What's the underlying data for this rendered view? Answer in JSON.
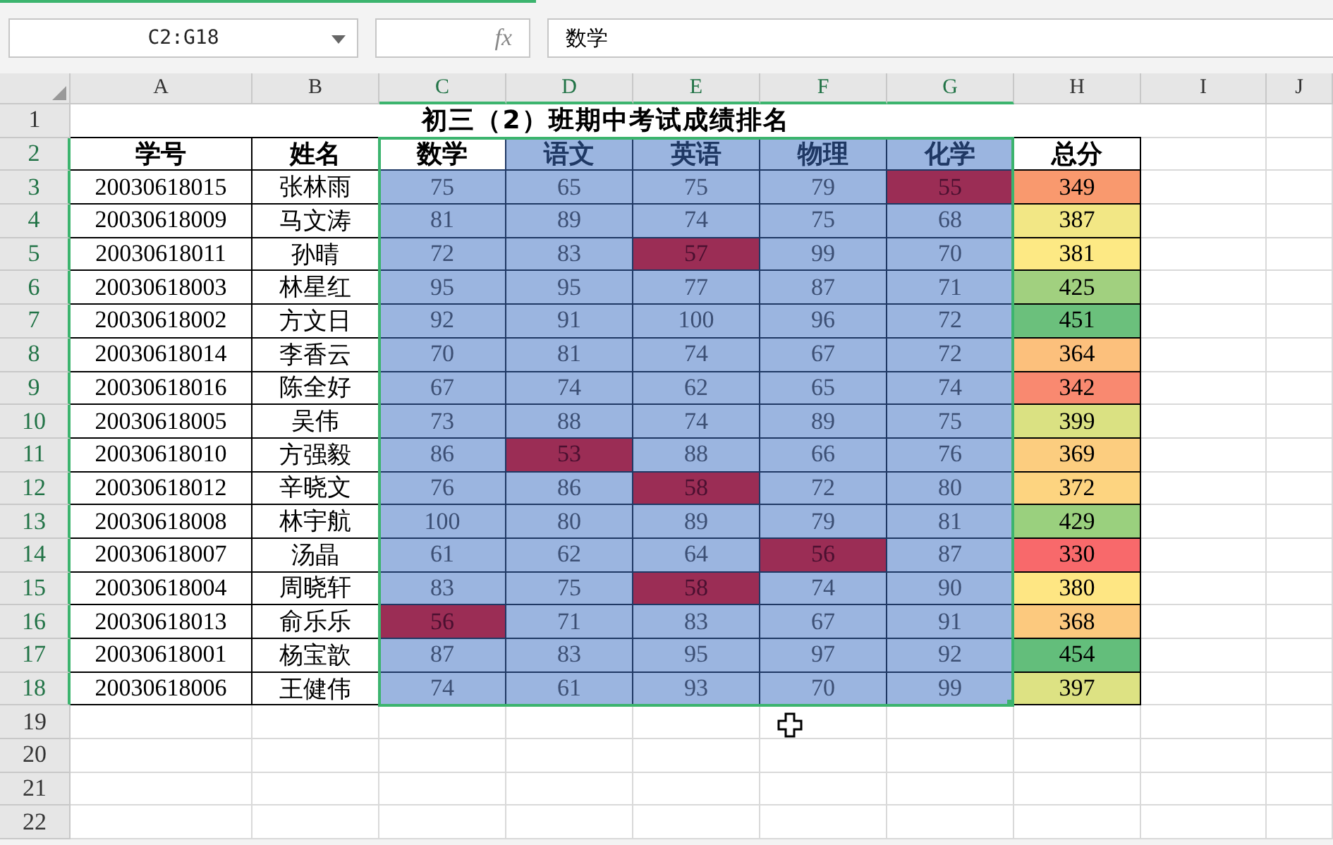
{
  "formula_bar": {
    "name_box": "C2:G18",
    "fx": "fx",
    "formula": "数学"
  },
  "column_headers": [
    {
      "label": "A",
      "selected": false
    },
    {
      "label": "B",
      "selected": false
    },
    {
      "label": "C",
      "selected": true
    },
    {
      "label": "D",
      "selected": true
    },
    {
      "label": "E",
      "selected": true
    },
    {
      "label": "F",
      "selected": true
    },
    {
      "label": "G",
      "selected": true
    },
    {
      "label": "H",
      "selected": false
    },
    {
      "label": "I",
      "selected": false
    },
    {
      "label": "J",
      "selected": false
    }
  ],
  "row_headers": [
    {
      "label": "1",
      "selected": false
    },
    {
      "label": "2",
      "selected": true
    },
    {
      "label": "3",
      "selected": true
    },
    {
      "label": "4",
      "selected": true
    },
    {
      "label": "5",
      "selected": true
    },
    {
      "label": "6",
      "selected": true
    },
    {
      "label": "7",
      "selected": true
    },
    {
      "label": "8",
      "selected": true
    },
    {
      "label": "9",
      "selected": true
    },
    {
      "label": "10",
      "selected": true
    },
    {
      "label": "11",
      "selected": true
    },
    {
      "label": "12",
      "selected": true
    },
    {
      "label": "13",
      "selected": true
    },
    {
      "label": "14",
      "selected": true
    },
    {
      "label": "15",
      "selected": true
    },
    {
      "label": "16",
      "selected": true
    },
    {
      "label": "17",
      "selected": true
    },
    {
      "label": "18",
      "selected": true
    },
    {
      "label": "19",
      "selected": false
    },
    {
      "label": "20",
      "selected": false
    },
    {
      "label": "21",
      "selected": false
    },
    {
      "label": "22",
      "selected": false
    }
  ],
  "table": {
    "title": "初三（2）班期中考试成绩排名",
    "headers": [
      {
        "label": "学号",
        "kind": "plain"
      },
      {
        "label": "姓名",
        "kind": "plain"
      },
      {
        "label": "数学",
        "kind": "subject",
        "active": true
      },
      {
        "label": "语文",
        "kind": "subject",
        "active": false
      },
      {
        "label": "英语",
        "kind": "subject",
        "active": false
      },
      {
        "label": "物理",
        "kind": "subject",
        "active": false
      },
      {
        "label": "化学",
        "kind": "subject",
        "active": false
      },
      {
        "label": "总分",
        "kind": "plain"
      }
    ],
    "rows": [
      {
        "id": "20030618015",
        "name": "张林雨",
        "scores": [
          {
            "value": "75",
            "low": false
          },
          {
            "value": "65",
            "low": false
          },
          {
            "value": "75",
            "low": false
          },
          {
            "value": "79",
            "low": false
          },
          {
            "value": "55",
            "low": true
          }
        ],
        "total": {
          "value": "349",
          "color": "#f9996e"
        }
      },
      {
        "id": "20030618009",
        "name": "马文涛",
        "scores": [
          {
            "value": "81",
            "low": false
          },
          {
            "value": "89",
            "low": false
          },
          {
            "value": "74",
            "low": false
          },
          {
            "value": "75",
            "low": false
          },
          {
            "value": "68",
            "low": false
          }
        ],
        "total": {
          "value": "387",
          "color": "#f2e785"
        }
      },
      {
        "id": "20030618011",
        "name": "孙晴",
        "scores": [
          {
            "value": "72",
            "low": false
          },
          {
            "value": "83",
            "low": false
          },
          {
            "value": "57",
            "low": true
          },
          {
            "value": "99",
            "low": false
          },
          {
            "value": "70",
            "low": false
          }
        ],
        "total": {
          "value": "381",
          "color": "#fde984"
        }
      },
      {
        "id": "20030618003",
        "name": "林星红",
        "scores": [
          {
            "value": "95",
            "low": false
          },
          {
            "value": "95",
            "low": false
          },
          {
            "value": "77",
            "low": false
          },
          {
            "value": "87",
            "low": false
          },
          {
            "value": "71",
            "low": false
          }
        ],
        "total": {
          "value": "425",
          "color": "#a1d07f"
        }
      },
      {
        "id": "20030618002",
        "name": "方文日",
        "scores": [
          {
            "value": "92",
            "low": false
          },
          {
            "value": "91",
            "low": false
          },
          {
            "value": "100",
            "low": false
          },
          {
            "value": "96",
            "low": false
          },
          {
            "value": "72",
            "low": false
          }
        ],
        "total": {
          "value": "451",
          "color": "#6bc07c"
        }
      },
      {
        "id": "20030618014",
        "name": "李香云",
        "scores": [
          {
            "value": "70",
            "low": false
          },
          {
            "value": "81",
            "low": false
          },
          {
            "value": "74",
            "low": false
          },
          {
            "value": "67",
            "low": false
          },
          {
            "value": "72",
            "low": false
          }
        ],
        "total": {
          "value": "364",
          "color": "#fcc07c"
        }
      },
      {
        "id": "20030618016",
        "name": "陈全好",
        "scores": [
          {
            "value": "67",
            "low": false
          },
          {
            "value": "74",
            "low": false
          },
          {
            "value": "62",
            "low": false
          },
          {
            "value": "65",
            "low": false
          },
          {
            "value": "74",
            "low": false
          }
        ],
        "total": {
          "value": "342",
          "color": "#f98970"
        }
      },
      {
        "id": "20030618005",
        "name": "吴伟",
        "scores": [
          {
            "value": "73",
            "low": false
          },
          {
            "value": "88",
            "low": false
          },
          {
            "value": "74",
            "low": false
          },
          {
            "value": "89",
            "low": false
          },
          {
            "value": "75",
            "low": false
          }
        ],
        "total": {
          "value": "399",
          "color": "#dae182"
        }
      },
      {
        "id": "20030618010",
        "name": "方强毅",
        "scores": [
          {
            "value": "86",
            "low": false
          },
          {
            "value": "53",
            "low": true
          },
          {
            "value": "88",
            "low": false
          },
          {
            "value": "66",
            "low": false
          },
          {
            "value": "76",
            "low": false
          }
        ],
        "total": {
          "value": "369",
          "color": "#fccd7f"
        }
      },
      {
        "id": "20030618012",
        "name": "辛晓文",
        "scores": [
          {
            "value": "76",
            "low": false
          },
          {
            "value": "86",
            "low": false
          },
          {
            "value": "58",
            "low": true
          },
          {
            "value": "72",
            "low": false
          },
          {
            "value": "80",
            "low": false
          }
        ],
        "total": {
          "value": "372",
          "color": "#fdd480"
        }
      },
      {
        "id": "20030618008",
        "name": "林宇航",
        "scores": [
          {
            "value": "100",
            "low": false
          },
          {
            "value": "80",
            "low": false
          },
          {
            "value": "89",
            "low": false
          },
          {
            "value": "79",
            "low": false
          },
          {
            "value": "81",
            "low": false
          }
        ],
        "total": {
          "value": "429",
          "color": "#9ad07e"
        }
      },
      {
        "id": "20030618007",
        "name": "汤晶",
        "scores": [
          {
            "value": "61",
            "low": false
          },
          {
            "value": "62",
            "low": false
          },
          {
            "value": "64",
            "low": false
          },
          {
            "value": "56",
            "low": true
          },
          {
            "value": "87",
            "low": false
          }
        ],
        "total": {
          "value": "330",
          "color": "#f8696b"
        }
      },
      {
        "id": "20030618004",
        "name": "周晓轩",
        "scores": [
          {
            "value": "83",
            "low": false
          },
          {
            "value": "75",
            "low": false
          },
          {
            "value": "58",
            "low": true
          },
          {
            "value": "74",
            "low": false
          },
          {
            "value": "90",
            "low": false
          }
        ],
        "total": {
          "value": "380",
          "color": "#fee683"
        }
      },
      {
        "id": "20030618013",
        "name": "俞乐乐",
        "scores": [
          {
            "value": "56",
            "low": true
          },
          {
            "value": "71",
            "low": false
          },
          {
            "value": "83",
            "low": false
          },
          {
            "value": "67",
            "low": false
          },
          {
            "value": "91",
            "low": false
          }
        ],
        "total": {
          "value": "368",
          "color": "#fcc97e"
        }
      },
      {
        "id": "20030618001",
        "name": "杨宝歆",
        "scores": [
          {
            "value": "87",
            "low": false
          },
          {
            "value": "83",
            "low": false
          },
          {
            "value": "95",
            "low": false
          },
          {
            "value": "97",
            "low": false
          },
          {
            "value": "92",
            "low": false
          }
        ],
        "total": {
          "value": "454",
          "color": "#63be7b"
        }
      },
      {
        "id": "20030618006",
        "name": "王健伟",
        "scores": [
          {
            "value": "74",
            "low": false
          },
          {
            "value": "61",
            "low": false
          },
          {
            "value": "93",
            "low": false
          },
          {
            "value": "70",
            "low": false
          },
          {
            "value": "99",
            "low": false
          }
        ],
        "total": {
          "value": "397",
          "color": "#dde283"
        }
      }
    ]
  }
}
